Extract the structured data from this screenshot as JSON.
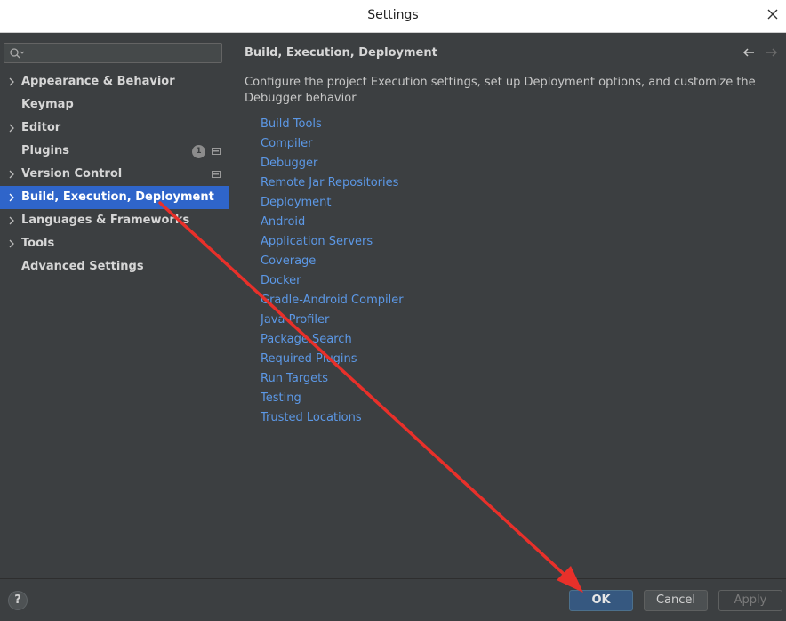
{
  "window": {
    "title": "Settings",
    "close_icon": "close-icon"
  },
  "search": {
    "value": "",
    "placeholder": ""
  },
  "sidebar": {
    "items": [
      {
        "label": "Appearance & Behavior",
        "expandable": true
      },
      {
        "label": "Keymap",
        "expandable": false
      },
      {
        "label": "Editor",
        "expandable": true
      },
      {
        "label": "Plugins",
        "expandable": false,
        "badge": "1"
      },
      {
        "label": "Version Control",
        "expandable": true
      },
      {
        "label": "Build, Execution, Deployment",
        "expandable": true,
        "selected": true
      },
      {
        "label": "Languages & Frameworks",
        "expandable": true
      },
      {
        "label": "Tools",
        "expandable": true
      },
      {
        "label": "Advanced Settings",
        "expandable": false
      }
    ]
  },
  "content": {
    "heading": "Build, Execution, Deployment",
    "description": "Configure the project Execution settings, set up Deployment options, and customize the Debugger behavior",
    "links": [
      "Build Tools",
      "Compiler",
      "Debugger",
      "Remote Jar Repositories",
      "Deployment",
      "Android",
      "Application Servers",
      "Coverage",
      "Docker",
      "Gradle-Android Compiler",
      "Java Profiler",
      "Package Search",
      "Required Plugins",
      "Run Targets",
      "Testing",
      "Trusted Locations"
    ]
  },
  "footer": {
    "help_label": "?",
    "ok_label": "OK",
    "cancel_label": "Cancel",
    "apply_label": "Apply"
  },
  "colors": {
    "background": "#3c3f41",
    "selection": "#2f65ca",
    "link": "#5c98e6",
    "annotation_arrow": "#e8302a"
  }
}
